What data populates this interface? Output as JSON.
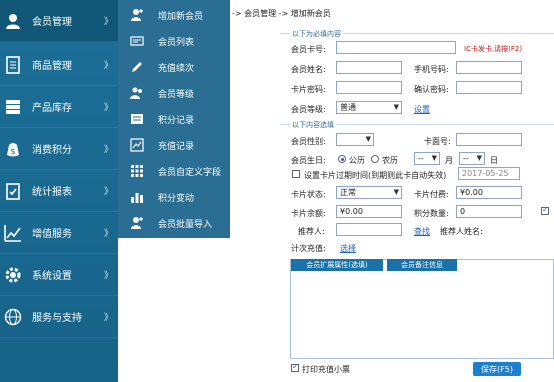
{
  "nav": {
    "items": [
      {
        "label": "会员管理",
        "icon": "member-icon",
        "chevron": "》"
      },
      {
        "label": "商品管理",
        "icon": "goods-icon",
        "chevron": "》"
      },
      {
        "label": "产品库存",
        "icon": "inventory-icon",
        "chevron": "》"
      },
      {
        "label": "消费积分",
        "icon": "money-icon",
        "chevron": "》"
      },
      {
        "label": "统计报表",
        "icon": "report-icon",
        "chevron": "》"
      },
      {
        "label": "增值服务",
        "icon": "chart-icon",
        "chevron": "》"
      },
      {
        "label": "系统设置",
        "icon": "gear-icon",
        "chevron": "》"
      },
      {
        "label": "服务与支持",
        "icon": "globe-icon",
        "chevron": "》"
      }
    ]
  },
  "submenu": {
    "items": [
      {
        "label": "增加新会员",
        "icon": "add-user-icon"
      },
      {
        "label": "会员列表",
        "icon": "card-list-icon"
      },
      {
        "label": "充值续次",
        "icon": "pen-icon"
      },
      {
        "label": "会员等级",
        "icon": "users-icon"
      },
      {
        "label": "积分记录",
        "icon": "points-icon"
      },
      {
        "label": "充值记录",
        "icon": "recharge-icon"
      },
      {
        "label": "会员自定义字段",
        "icon": "grid-icon"
      },
      {
        "label": "积分变动",
        "icon": "bar-chart-icon"
      },
      {
        "label": "会员批量导入",
        "icon": "import-user-icon"
      }
    ]
  },
  "breadcrumb": "-> 会员管理 -> 增加新会员",
  "required_section": "以下为必填内容",
  "optional_section": "以下内容选填",
  "form": {
    "card_no_label": "会员卡号:",
    "card_no_value": "",
    "ic_hint": "IC卡发卡,请按(F2)",
    "name_label": "会员姓名:",
    "name_value": "",
    "phone_label": "手机号码:",
    "phone_value": "",
    "password_label": "卡片密码:",
    "password_value": "",
    "confirm_label": "确认密码:",
    "confirm_value": "",
    "level_label": "会员等级:",
    "level_value": "普通",
    "level_setting": "设置",
    "gender_label": "会员性别:",
    "gender_value": "",
    "card_face_label": "卡面号:",
    "card_face_value": "",
    "birthday_label": "会员生日:",
    "solar_label": "公历",
    "lunar_label": "农历",
    "month_value": "--",
    "month_label": "月",
    "day_value": "--",
    "day_label": "日",
    "expire_label": "设置卡片过期时间(到期则此卡自动失效)",
    "expire_value": "2017-05-25",
    "status_label": "卡片状态:",
    "status_value": "正常",
    "fee_label": "卡片付费:",
    "fee_value": "¥0.00",
    "balance_label": "卡片余额:",
    "balance_value": "¥0.00",
    "points_label": "积分数量:",
    "points_value": "0",
    "referrer_label": "推荐人:",
    "referrer_value": "",
    "find_link": "查找",
    "referrer_name_label": "推荐人姓名:",
    "recharge_label": "计次充值:",
    "recharge_link": "选择",
    "tab1": "会员扩展属性(选填)",
    "tab2": "会员备注信息",
    "print_label": "打印充值小票",
    "save_button": "保存(F5)"
  },
  "colors": {
    "nav_bg": "#1c6f98",
    "submenu_bg": "#2a6f93",
    "accent": "#1c7fd0",
    "hint_red": "#d01818"
  }
}
